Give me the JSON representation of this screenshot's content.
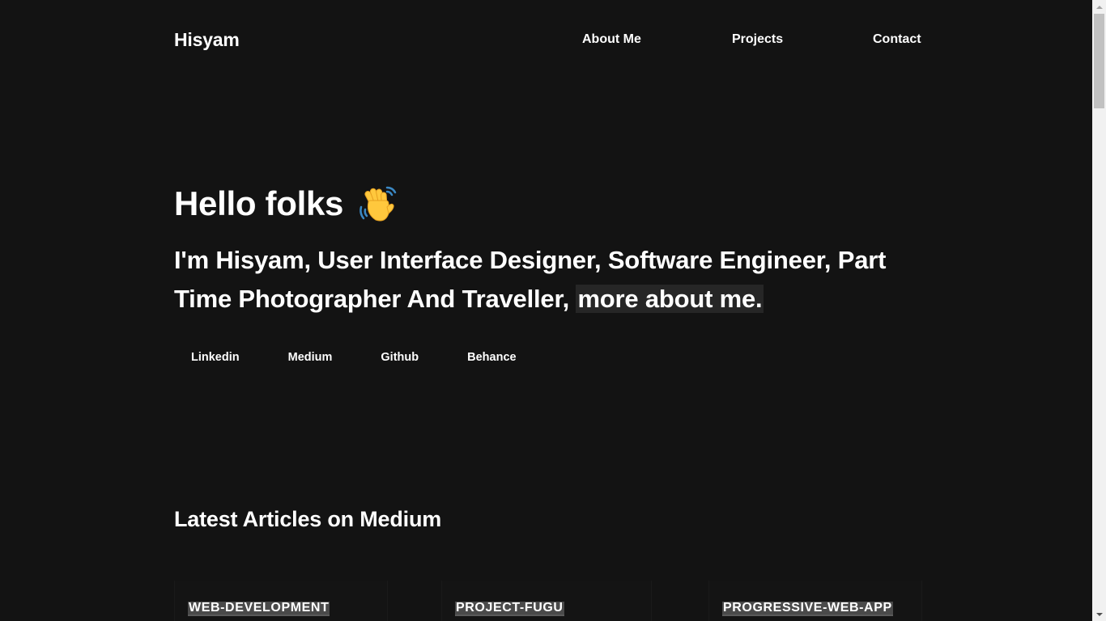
{
  "header": {
    "brand": "Hisyam",
    "nav": [
      {
        "label": "About Me"
      },
      {
        "label": "Projects"
      },
      {
        "label": "Contact"
      }
    ]
  },
  "hero": {
    "greeting": "Hello folks",
    "greeting_icon": "waving-hand-icon",
    "intro": "I'm Hisyam, User Interface Designer, Software Engineer, Part Time Photographer And Traveller,",
    "more_link": "more about me.",
    "social": [
      {
        "label": "Linkedin"
      },
      {
        "label": "Medium"
      },
      {
        "label": "Github"
      },
      {
        "label": "Behance"
      }
    ]
  },
  "articles": {
    "heading": "Latest Articles on Medium",
    "cards": [
      {
        "tag": "WEB-DEVELOPMENT"
      },
      {
        "tag": "PROJECT-FUGU"
      },
      {
        "tag": "PROGRESSIVE-WEB-APP"
      }
    ]
  },
  "colors": {
    "background": "#131313",
    "text": "#ffffff",
    "link_highlight": "#262626",
    "tag_highlight": "#4a4a4a"
  }
}
